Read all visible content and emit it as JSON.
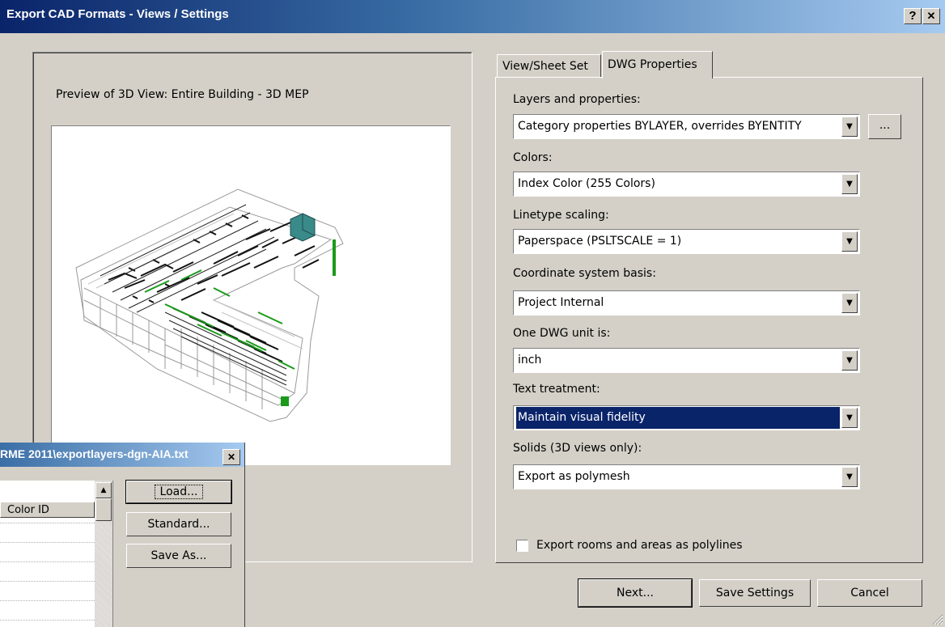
{
  "window": {
    "title": "Export CAD Formats - Views / Settings",
    "help_glyph": "?",
    "close_glyph": "✕"
  },
  "preview": {
    "label": "Preview of 3D View: Entire Building - 3D MEP"
  },
  "tabs": [
    {
      "label": "View/Sheet Set",
      "active": false
    },
    {
      "label": "DWG Properties",
      "active": true
    }
  ],
  "properties": {
    "layers": {
      "label": "Layers and properties:",
      "value": "Category properties BYLAYER, overrides BYENTITY",
      "browse_label": "..."
    },
    "colors": {
      "label": "Colors:",
      "value": "Index Color (255 Colors)"
    },
    "linetype": {
      "label": "Linetype scaling:",
      "value": "Paperspace (PSLTSCALE = 1)"
    },
    "coords": {
      "label": "Coordinate system basis:",
      "value": "Project Internal"
    },
    "unit": {
      "label": "One DWG unit is:",
      "value": "inch"
    },
    "text": {
      "label": "Text treatment:",
      "value": "Maintain visual fidelity"
    },
    "solids": {
      "label": "Solids (3D views only):",
      "value": "Export as polymesh"
    },
    "export_rooms": {
      "label": "Export rooms and areas as polylines",
      "checked": false
    }
  },
  "buttons": {
    "next": "Next...",
    "save_settings": "Save Settings",
    "cancel": "Cancel"
  },
  "layer_dialog": {
    "title": "RME 2011\\exportlayers-dgn-AIA.txt",
    "close_glyph": "✕",
    "column_header": "Color ID",
    "load_label": "Load...",
    "standard_label": "Standard...",
    "save_as_label": "Save As..."
  }
}
